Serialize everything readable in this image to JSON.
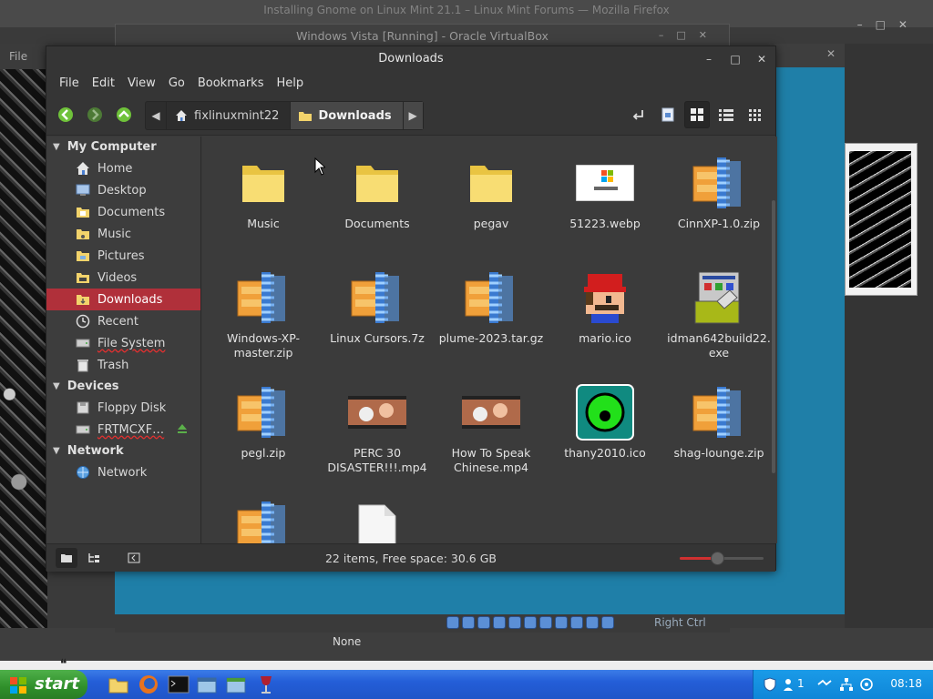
{
  "background": {
    "firefox_title": "Installing Gnome on Linux Mint 21.1 – Linux Mint Forums — Mozilla Firefox",
    "firefox_menu_file": "File",
    "virtualbox_title": "Windows Vista [Running] - Oracle VirtualBox",
    "vb_host_key": "Right Ctrl",
    "firefox_status": "None"
  },
  "window": {
    "title": "Downloads",
    "menu": [
      "File",
      "Edit",
      "View",
      "Go",
      "Bookmarks",
      "Help"
    ]
  },
  "breadcrumbs": [
    {
      "label": "fixlinuxmint22",
      "icon": "home-icon"
    },
    {
      "label": "Downloads",
      "icon": "folder-icon",
      "active": true
    }
  ],
  "sidebar": {
    "sections": [
      {
        "label": "My Computer",
        "items": [
          {
            "label": "Home",
            "icon": "home-icon"
          },
          {
            "label": "Desktop",
            "icon": "desktop-icon"
          },
          {
            "label": "Documents",
            "icon": "documents-icon"
          },
          {
            "label": "Music",
            "icon": "music-icon"
          },
          {
            "label": "Pictures",
            "icon": "pictures-icon"
          },
          {
            "label": "Videos",
            "icon": "videos-icon"
          },
          {
            "label": "Downloads",
            "icon": "downloads-icon",
            "active": true
          },
          {
            "label": "Recent",
            "icon": "recent-icon"
          },
          {
            "label": "File System",
            "icon": "filesystem-icon"
          },
          {
            "label": "Trash",
            "icon": "trash-icon"
          }
        ]
      },
      {
        "label": "Devices",
        "items": [
          {
            "label": "Floppy Disk",
            "icon": "floppy-icon"
          },
          {
            "label": "FRTMCXF…",
            "icon": "drive-icon",
            "eject": true
          }
        ]
      },
      {
        "label": "Network",
        "items": [
          {
            "label": "Network",
            "icon": "network-icon"
          }
        ]
      }
    ]
  },
  "files": [
    {
      "name": "Music",
      "icon": "folder-icon"
    },
    {
      "name": "Documents",
      "icon": "folder-icon"
    },
    {
      "name": "pegav",
      "icon": "folder-icon"
    },
    {
      "name": "51223.webp",
      "icon": "windows7-image-icon"
    },
    {
      "name": "CinnXP-1.0.zip",
      "icon": "zip-archive-icon"
    },
    {
      "name": "Windows-XP-master.zip",
      "icon": "zip-archive-icon"
    },
    {
      "name": "Linux Cursors.7z",
      "icon": "zip-archive-icon"
    },
    {
      "name": "plume-2023.tar.gz",
      "icon": "zip-archive-icon"
    },
    {
      "name": "mario.ico",
      "icon": "mario-icon"
    },
    {
      "name": "idman642build22.exe",
      "icon": "installer-icon"
    },
    {
      "name": "pegl.zip",
      "icon": "zip-archive-icon"
    },
    {
      "name": "PERC 30 DISASTER!!!.mp4",
      "icon": "video-thumbnail-icon"
    },
    {
      "name": "How To Speak Chinese.mp4",
      "icon": "video-thumbnail-icon"
    },
    {
      "name": "thany2010.ico",
      "icon": "green-eye-icon"
    },
    {
      "name": "shag-lounge.zip",
      "icon": "zip-archive-icon"
    },
    {
      "name": "",
      "icon": "zip-archive-icon"
    },
    {
      "name": "",
      "icon": "blank-document-icon"
    }
  ],
  "status": {
    "summary": "22 items, Free space: 30.6 GB",
    "zoom_level": 0.45
  },
  "taskbar": {
    "start_label": "start",
    "tray_count": "1",
    "clock": "08:18"
  },
  "colors": {
    "accent": "#b0303a",
    "taskbar": "#245ed8",
    "start": "#2f8f2a",
    "vm_desktop": "#1f7fa8"
  }
}
